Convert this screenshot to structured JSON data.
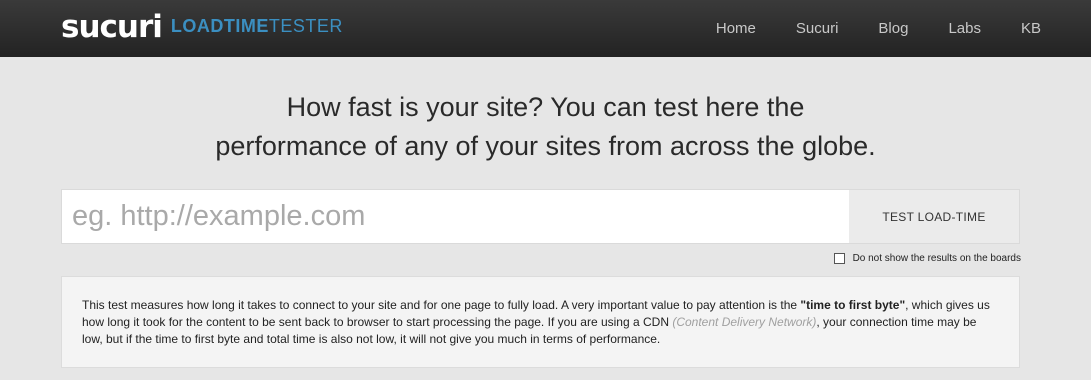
{
  "brand": {
    "logo": "SUCURI",
    "product_a": "LOADTIME",
    "product_b": "TESTER"
  },
  "nav": {
    "items": [
      "Home",
      "Sucuri",
      "Blog",
      "Labs",
      "KB"
    ]
  },
  "headline": {
    "line1": "How fast is your site? You can test here the",
    "line2": "performance of any of your sites from across the globe."
  },
  "form": {
    "url_placeholder": "eg. http://example.com",
    "url_value": "",
    "button_label": "TEST LOAD-TIME"
  },
  "options": {
    "hide_results_label": "Do not show the results on the boards",
    "hide_results_checked": false
  },
  "info": {
    "part1": "This test measures how long it takes to connect to your site and for one page to fully load. A very important value to pay attention is the ",
    "highlight": "\"time to first byte\"",
    "part2": ", which gives us how long it took for the content to be sent back to browser to start processing the page. If you are using a CDN ",
    "cdn": "(Content Delivery Network)",
    "part3": ", your connection time may be low, but if the time to first byte and total time is also not low, it will not give you much in terms of performance."
  }
}
